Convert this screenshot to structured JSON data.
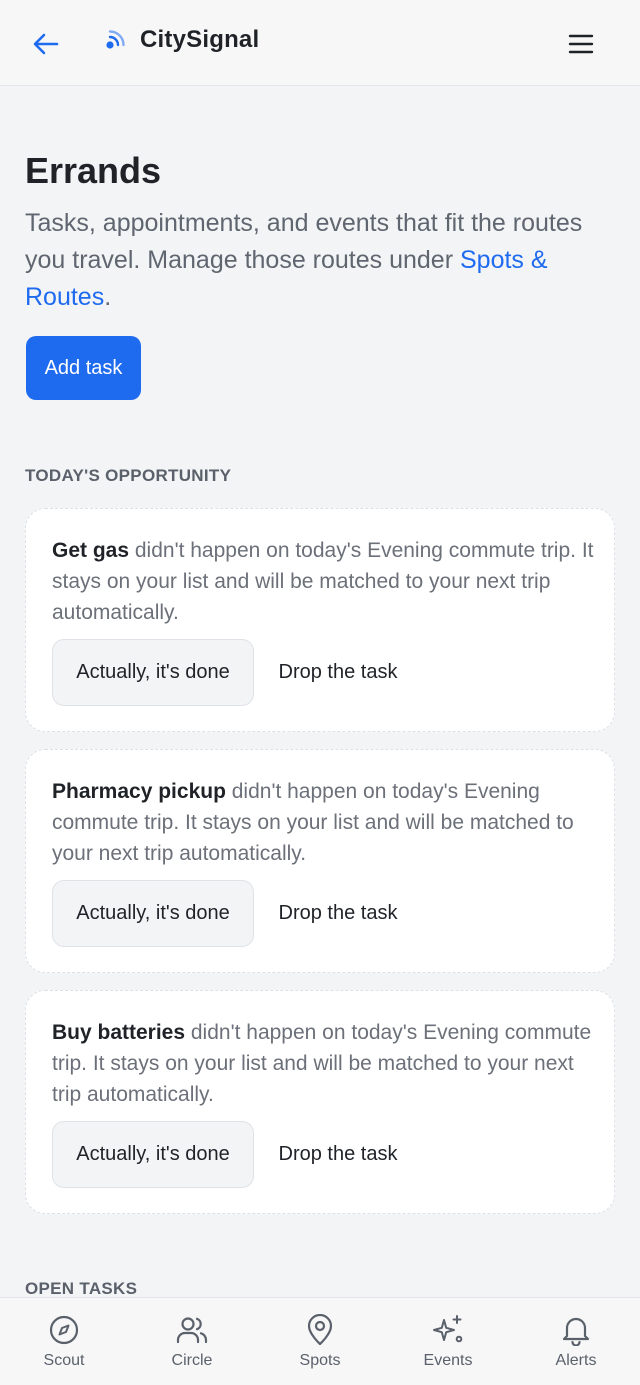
{
  "header": {
    "app_name": "CitySignal",
    "back_icon": "arrow-left-icon",
    "logo_icon": "signal-icon",
    "menu_icon": "hamburger-menu-icon"
  },
  "page": {
    "title": "Errands",
    "intro_text": "Tasks, appointments, and events that fit the routes you travel. Manage those routes under ",
    "intro_link": "Spots & Routes",
    "intro_end": ".",
    "add_button": "Add task"
  },
  "todays_opportunity": {
    "heading": "TODAY'S OPPORTUNITY",
    "cards": [
      {
        "task": "Get gas",
        "message": " didn't happen on today's Evening commute trip. It stays on your list and will be matched to your next trip automatically.",
        "done_label": "Actually, it's done",
        "drop_label": "Drop the task"
      },
      {
        "task": "Pharmacy pickup",
        "message": " didn't happen on today's Evening commute trip. It stays on your list and will be matched to your next trip automatically.",
        "done_label": "Actually, it's done",
        "drop_label": "Drop the task"
      },
      {
        "task": "Buy batteries",
        "message": " didn't happen on today's Evening commute trip. It stays on your list and will be matched to your next trip automatically.",
        "done_label": "Actually, it's done",
        "drop_label": "Drop the task"
      }
    ]
  },
  "open_tasks": {
    "heading": "OPEN TASKS"
  },
  "bottom_nav": [
    {
      "label": "Scout",
      "icon": "compass-icon"
    },
    {
      "label": "Circle",
      "icon": "people-icon"
    },
    {
      "label": "Spots",
      "icon": "map-pin-icon"
    },
    {
      "label": "Events",
      "icon": "sparkles-icon"
    },
    {
      "label": "Alerts",
      "icon": "bell-icon"
    }
  ],
  "colors": {
    "accent": "#1f6bf0",
    "background": "#f3f4f6",
    "card_background": "#ffffff",
    "muted_text": "#6b7079"
  }
}
